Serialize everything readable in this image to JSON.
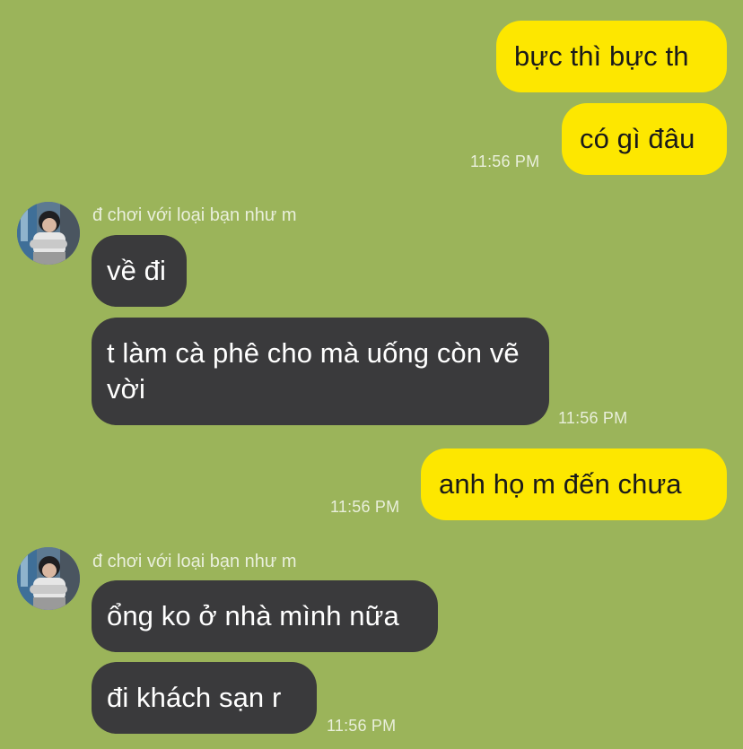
{
  "theme": {
    "background": "#9bb45a",
    "outgoing_bubble": "#fde700",
    "incoming_bubble": "#3a3a3c"
  },
  "messages": {
    "out1": {
      "text": "bực thì bực th"
    },
    "out2": {
      "text": "có gì đâu",
      "time": "11:56 PM"
    },
    "group1": {
      "sender": "đ chơi với loại bạn như m",
      "avatar_icon": "profile-photo-icon",
      "msg1": "về đi",
      "msg2": "t làm cà phê cho mà uống còn vẽ vời",
      "time": "11:56 PM"
    },
    "out3": {
      "text": "anh họ m đến chưa",
      "time": "11:56 PM"
    },
    "group2": {
      "sender": "đ chơi với loại bạn như m",
      "avatar_icon": "profile-photo-icon",
      "msg1": "ổng ko ở nhà mình nữa",
      "msg2": "đi khách sạn r",
      "time": "11:56 PM"
    }
  }
}
